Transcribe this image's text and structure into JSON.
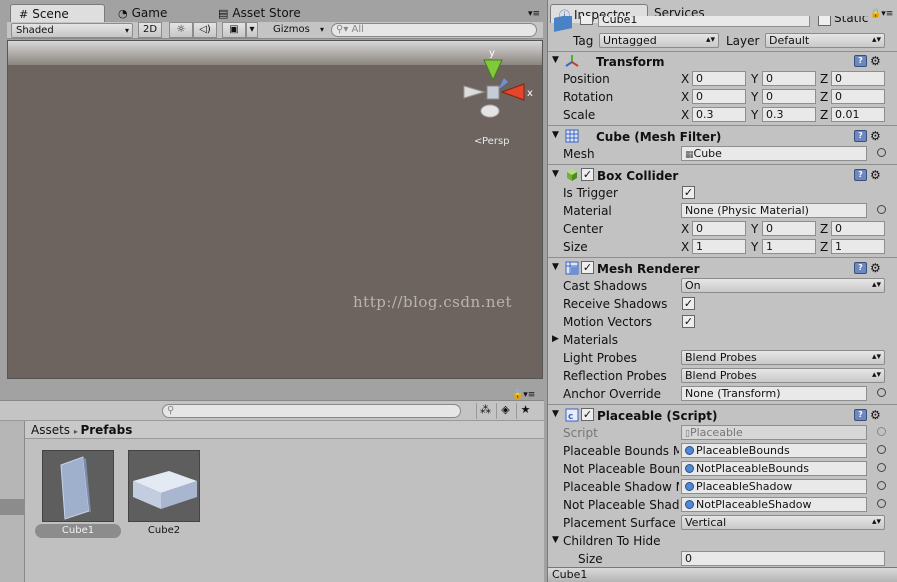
{
  "scene_panel": {
    "tabs": [
      {
        "label": "Scene",
        "icon": "scene-hash-icon"
      },
      {
        "label": "Game",
        "icon": "game-pacman-icon"
      },
      {
        "label": "Asset Store",
        "icon": "asset-store-bag-icon"
      }
    ],
    "shading_mode": "Shaded",
    "toggle_2d": "2D",
    "gizmos_label": "Gizmos",
    "search_placeholder": "All",
    "gizmo": {
      "y_label": "y",
      "x_label": "x",
      "persp_label": "Persp"
    },
    "watermark": "http://blog.csdn.net"
  },
  "project_panel": {
    "breadcrumb": {
      "root": "Assets",
      "current": "Prefabs"
    },
    "assets": [
      {
        "label": "Cube1",
        "selected": true
      },
      {
        "label": "Cube2",
        "selected": false
      }
    ]
  },
  "inspector": {
    "tabs": [
      {
        "label": "Inspector",
        "icon": "inspector-info-icon"
      },
      {
        "label": "Services"
      }
    ],
    "object_name": "Cube1",
    "static_label": "Static",
    "tag_label": "Tag",
    "tag_value": "Untagged",
    "layer_label": "Layer",
    "layer_value": "Default",
    "transform": {
      "title": "Transform",
      "position": {
        "label": "Position",
        "x": "0",
        "y": "0",
        "z": "0"
      },
      "rotation": {
        "label": "Rotation",
        "x": "0",
        "y": "0",
        "z": "0"
      },
      "scale": {
        "label": "Scale",
        "x": "0.3",
        "y": "0.3",
        "z": "0.01"
      }
    },
    "mesh_filter": {
      "title": "Cube (Mesh Filter)",
      "mesh_label": "Mesh",
      "mesh_value": "Cube"
    },
    "box_collider": {
      "title": "Box Collider",
      "is_trigger_label": "Is Trigger",
      "material_label": "Material",
      "material_value": "None (Physic Material)",
      "center": {
        "label": "Center",
        "x": "0",
        "y": "0",
        "z": "0"
      },
      "size": {
        "label": "Size",
        "x": "1",
        "y": "1",
        "z": "1"
      }
    },
    "mesh_renderer": {
      "title": "Mesh Renderer",
      "cast_shadows_label": "Cast Shadows",
      "cast_shadows_value": "On",
      "receive_shadows_label": "Receive Shadows",
      "motion_vectors_label": "Motion Vectors",
      "materials_label": "Materials",
      "light_probes_label": "Light Probes",
      "light_probes_value": "Blend Probes",
      "reflection_probes_label": "Reflection Probes",
      "reflection_probes_value": "Blend Probes",
      "anchor_override_label": "Anchor Override",
      "anchor_override_value": "None (Transform)"
    },
    "placeable": {
      "title": "Placeable (Script)",
      "script_label": "Script",
      "script_value": "Placeable",
      "bounds_label": "Placeable Bounds Ma",
      "bounds_value": "PlaceableBounds",
      "not_bounds_label": "Not Placeable Bound",
      "not_bounds_value": "NotPlaceableBounds",
      "shadow_label": "Placeable Shadow M",
      "shadow_value": "PlaceableShadow",
      "not_shadow_label": "Not Placeable Shado",
      "not_shadow_value": "NotPlaceableShadow",
      "surface_label": "Placement Surface",
      "surface_value": "Vertical",
      "children_label": "Children To Hide",
      "children_size_label": "Size",
      "children_size_value": "0"
    },
    "footer_label": "Cube1"
  }
}
